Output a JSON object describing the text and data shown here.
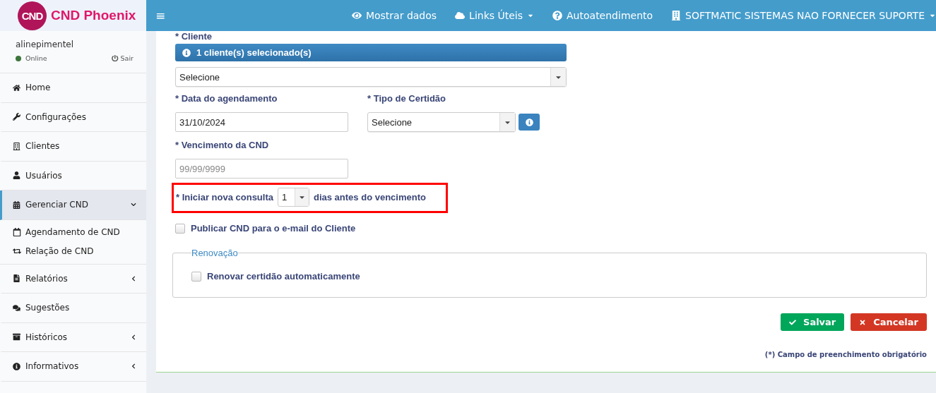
{
  "brand": {
    "badge": "CND",
    "name": "CND Phoenix"
  },
  "user": {
    "name": "alinepimentel",
    "status": "Online",
    "logout": "Sair"
  },
  "sidebar": {
    "items": [
      {
        "label": "Home",
        "kind": "link",
        "selected": false
      },
      {
        "label": "Configurações",
        "kind": "link",
        "selected": false
      },
      {
        "label": "Clientes",
        "kind": "link",
        "selected": false
      },
      {
        "label": "Usuários",
        "kind": "link",
        "selected": false
      },
      {
        "label": "Gerenciar CND",
        "kind": "group",
        "expanded": true,
        "selected": true,
        "children": [
          {
            "label": "Agendamento de CND",
            "selected": false
          },
          {
            "label": "Relação de CND",
            "selected": false
          }
        ]
      },
      {
        "label": "Relatórios",
        "kind": "group",
        "expanded": false,
        "selected": false
      },
      {
        "label": "Sugestões",
        "kind": "link",
        "selected": false
      },
      {
        "label": "Históricos",
        "kind": "group",
        "expanded": false,
        "selected": false
      },
      {
        "label": "Informativos",
        "kind": "group",
        "expanded": false,
        "selected": false
      }
    ]
  },
  "topbar": {
    "menu_glyph": "≡",
    "items": [
      {
        "label": "Mostrar dados",
        "dropdown": false
      },
      {
        "label": "Links Úteis",
        "dropdown": true
      },
      {
        "label": "Autoatendimento",
        "dropdown": false
      },
      {
        "label": "SOFTMATIC SISTEMAS NAO FORNECER SUPORTE",
        "dropdown": true
      }
    ]
  },
  "form": {
    "cliente": {
      "label": "* Cliente",
      "info": "1 cliente(s) selecionado(s)",
      "select": "Selecione"
    },
    "data": {
      "label": "* Data do agendamento",
      "value": "31/10/2024"
    },
    "tipo": {
      "label": "* Tipo de Certidão",
      "select": "Selecione"
    },
    "vencimento": {
      "label": "* Vencimento da CND",
      "placeholder": "99/99/9999"
    },
    "consulta": {
      "label": "* Iniciar nova consulta",
      "value": "1",
      "suffix": "dias antes do vencimento",
      "highlighted": true
    },
    "publicar": {
      "label": "Publicar CND para o e-mail do Cliente",
      "checked": false
    },
    "renovacao": {
      "legend": "Renovação",
      "label": "Renovar certidão automaticamente",
      "checked": false
    },
    "buttons": [
      {
        "label": "Salvar",
        "kind": "save"
      },
      {
        "label": "Cancelar",
        "kind": "cancel"
      }
    ],
    "note": "(*) Campo de preenchimento obrigatório"
  }
}
